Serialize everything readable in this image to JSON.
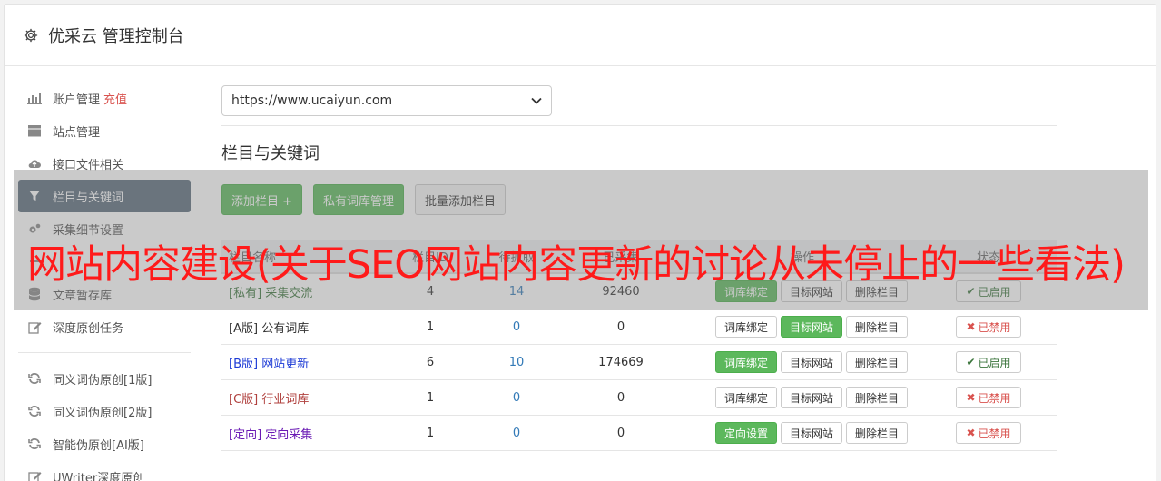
{
  "header": {
    "title": "优采云 管理控制台",
    "icon": "gear-icon"
  },
  "sidebar": {
    "items": [
      {
        "label": "账户管理",
        "extra": "充值",
        "icon": "bar-chart-icon"
      },
      {
        "label": "站点管理",
        "icon": "server-icon"
      },
      {
        "label": "接口文件相关",
        "icon": "cloud-upload-icon"
      },
      {
        "label": "栏目与关键词",
        "icon": "filter-icon"
      },
      {
        "label": "采集细节设置",
        "icon": "gears-icon"
      },
      {
        "label": "",
        "icon": "tool-icon"
      },
      {
        "label": "文章暂存库",
        "icon": "database-icon"
      },
      {
        "label": "深度原创任务",
        "icon": "edit-icon"
      }
    ],
    "items2": [
      {
        "label": "同义词伪原创[1版]",
        "icon": "refresh-icon"
      },
      {
        "label": "同义词伪原创[2版]",
        "icon": "refresh-icon"
      },
      {
        "label": "智能伪原创[AI版]",
        "icon": "refresh-icon"
      },
      {
        "label": "UWriter深度原创",
        "icon": "edit-icon"
      }
    ]
  },
  "main": {
    "site_select": "https://www.ucaiyun.com",
    "section_title": "栏目与关键词",
    "buttons": {
      "add_column": "添加栏目 +",
      "private_lib": "私有词库管理",
      "batch_add": "批量添加栏目"
    }
  },
  "table": {
    "headers": {
      "name": "栏目名称",
      "id": "栏目ID",
      "kw": "待抓取",
      "count": "已采集",
      "ops": "操作",
      "status": "状态"
    },
    "rows": [
      {
        "tag": "[私有]",
        "name": "采集交流",
        "id": "4",
        "kw": "14",
        "count": "92460",
        "op1": "词库绑定",
        "op2": "目标网站",
        "op3": "删除栏目",
        "status": "已启用"
      },
      {
        "tag": "[A版]",
        "name": "公有词库",
        "id": "1",
        "kw": "0",
        "count": "0",
        "op1": "词库绑定",
        "op2": "目标网站",
        "op3": "删除栏目",
        "status": "已禁用"
      },
      {
        "tag": "[B版]",
        "name": "网站更新",
        "id": "6",
        "kw": "10",
        "count": "174669",
        "op1": "词库绑定",
        "op2": "目标网站",
        "op3": "删除栏目",
        "status": "已启用"
      },
      {
        "tag": "[C版]",
        "name": "行业词库",
        "id": "1",
        "kw": "0",
        "count": "0",
        "op1": "词库绑定",
        "op2": "目标网站",
        "op3": "删除栏目",
        "status": "已禁用"
      },
      {
        "tag": "[定向]",
        "name": "定向采集",
        "id": "1",
        "kw": "0",
        "count": "0",
        "op1": "定向设置",
        "op2": "目标网站",
        "op3": "删除栏目",
        "status": "已禁用"
      }
    ]
  },
  "overlay": {
    "headline": "网站内容建设(关于SEO网站内容更新的讨论从未停止的一些看法)"
  },
  "colors": {
    "green": "#5cb85c",
    "active_side": "#5a6b7b",
    "red": "#ff1a1a"
  }
}
